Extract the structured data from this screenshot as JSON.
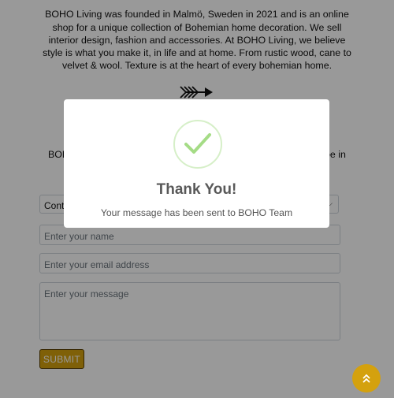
{
  "about": {
    "paragraph": "BOHO Living was founded in Malmö, Sweden in 2021 and is an online shop for a unique collection of Bohemian home decoration. We sell interior design, fashion and accessories. At BOHO Living, we believe style is what you make it, in life and at home. From rustic wood, cane to velvet & wool. Texture is at the heart of every bohemian home."
  },
  "contact": {
    "intro_left": "BOH",
    "intro_right": "be in",
    "select_value": "Conta",
    "name_placeholder": "Enter your name",
    "email_placeholder": "Enter your email address",
    "message_placeholder": "Enter your message",
    "submit_label": "SUBMIT"
  },
  "modal": {
    "title": "Thank You!",
    "text": "Your message has been sent to BOHO Team"
  },
  "icons": {
    "arrow": "arrow-icon",
    "check": "check-icon",
    "scroll_top": "double-chevron-up-icon",
    "select_chevron": "chevron-down-icon"
  },
  "colors": {
    "accent": "#d4a10e",
    "success": "#a5dc86",
    "overlay": "rgba(0,0,0,0.4)"
  }
}
